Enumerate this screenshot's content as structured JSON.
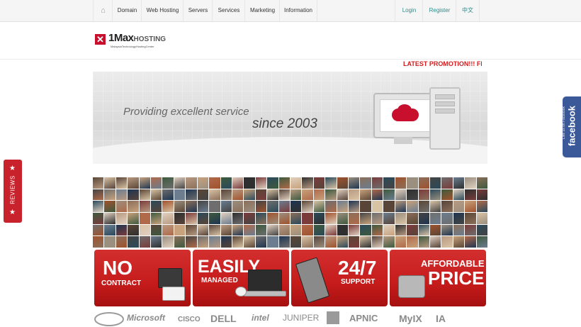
{
  "nav": {
    "home_icon": "home-icon",
    "items": [
      "Domain",
      "Web Hosting",
      "Servers",
      "Services",
      "Marketing",
      "Information"
    ],
    "login": "Login",
    "register": "Register",
    "chinese": "中文"
  },
  "logo": {
    "mark": "✕",
    "text_prefix": "1Max",
    "text_suffix": "HOSTING",
    "tagline": "MalaysiaTechnologyHostingCenter"
  },
  "promo": "LATEST PROMOTION!!! FREE",
  "banner": {
    "line1": "Providing excellent service",
    "line2": "since 2003"
  },
  "features": [
    {
      "big": "NO",
      "small": "CONTRACT"
    },
    {
      "big": "EASILY",
      "small": "MANAGED"
    },
    {
      "big": "24/7",
      "small": "SUPPORT"
    },
    {
      "top": "AFFORDABLE",
      "big": "PRICE"
    }
  ],
  "partners": [
    "Microsoft",
    "CISCO",
    "DELL",
    "intel",
    "JUNIPER",
    "APNIC",
    "MyIX",
    "IA"
  ],
  "facebook_tab": {
    "brand": "facebook",
    "like": "Like us on Facebook"
  },
  "reviews_tab": "REVIEWS",
  "colors": {
    "accent": "#c8102e",
    "link": "#2a8c8c",
    "facebook": "#3b5998"
  }
}
